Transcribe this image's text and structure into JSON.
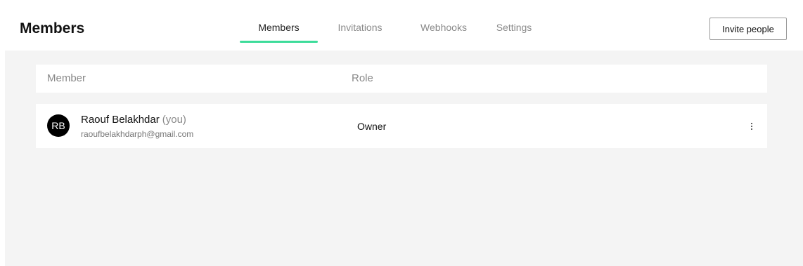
{
  "header": {
    "title": "Members",
    "tabs": [
      {
        "label": "Members",
        "active": true
      },
      {
        "label": "Invitations",
        "active": false
      },
      {
        "label": "Webhooks",
        "active": false
      },
      {
        "label": "Settings",
        "active": false
      }
    ],
    "invite_label": "Invite people"
  },
  "table": {
    "columns": [
      "Member",
      "Role"
    ],
    "rows": [
      {
        "avatar_initials": "RB",
        "name": "Raouf Belakhdar",
        "you_tag": "(you)",
        "email": "raoufbelakhdarph@gmail.com",
        "role": "Owner",
        "more_icon": "more-vertical-icon"
      }
    ]
  },
  "colors": {
    "active_tab_underline": "#3ddc9a",
    "content_background": "#f4f4f4",
    "avatar_background": "#000000"
  }
}
